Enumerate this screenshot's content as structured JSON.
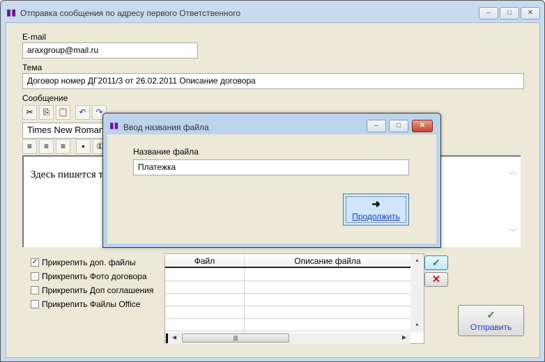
{
  "window": {
    "title": "Отправка сообщения по адресу первого Ответственного",
    "minimize": "▭",
    "maximize": "▣",
    "close": "✕"
  },
  "form": {
    "email_label": "E-mail",
    "email_value": "araxgroup@mail.ru",
    "subject_label": "Тема",
    "subject_value": "Договор номер ДГ2011/3 от 26.02.2011 Описание договора",
    "message_label": "Сообщение",
    "font_value": "Times New Roman",
    "message_text": "Здесь пишется т"
  },
  "checkboxes": [
    {
      "label": "Прикрепить доп. файлы",
      "checked": true
    },
    {
      "label": "Прикрепить Фото договора",
      "checked": false
    },
    {
      "label": "Прикрепить Доп соглашения",
      "checked": false
    },
    {
      "label": "Прикрепить Файлы Office",
      "checked": false
    }
  ],
  "grid": {
    "columns": [
      "Файл",
      "Описание файла"
    ]
  },
  "buttons": {
    "send": "Отправить"
  },
  "dialog": {
    "title": "Ввод названия файла",
    "field_label": "Название файла",
    "field_value": "Платежка",
    "continue": "Продолжить"
  }
}
